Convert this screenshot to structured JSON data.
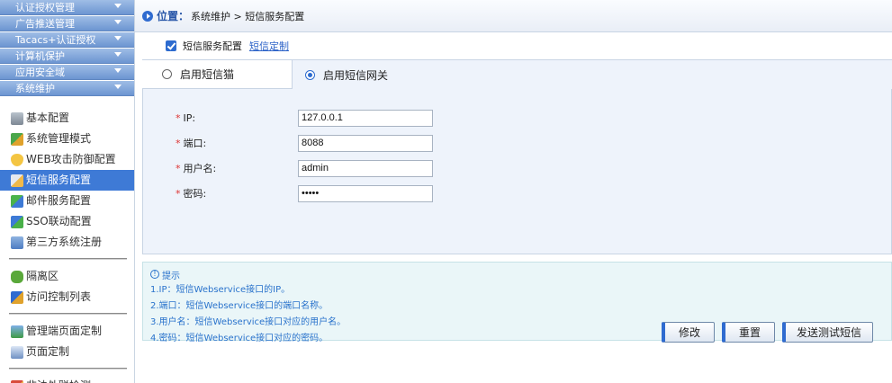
{
  "sidebar": {
    "headers": [
      {
        "label": "认证授权管理"
      },
      {
        "label": "广告推送管理"
      },
      {
        "label": "Tacacs+认证授权"
      },
      {
        "label": "计算机保护"
      },
      {
        "label": "应用安全域"
      },
      {
        "label": "系统维护"
      }
    ],
    "items": [
      {
        "label": "基本配置",
        "icon": "server-config-icon"
      },
      {
        "label": "系统管理模式",
        "icon": "tools-icon"
      },
      {
        "label": "WEB攻击防御配置",
        "icon": "shield-icon"
      },
      {
        "label": "短信服务配置",
        "icon": "sms-icon"
      },
      {
        "label": "邮件服务配置",
        "icon": "mail-icon"
      },
      {
        "label": "SSO联动配置",
        "icon": "sso-icon"
      },
      {
        "label": "第三方系统注册",
        "icon": "register-icon"
      },
      {
        "label": "隔离区",
        "icon": "quarantine-icon"
      },
      {
        "label": "访问控制列表",
        "icon": "acl-icon"
      },
      {
        "label": "管理端页面定制",
        "icon": "admin-page-icon"
      },
      {
        "label": "页面定制",
        "icon": "page-icon"
      },
      {
        "label": "非法外联检测",
        "icon": "detect-icon"
      }
    ]
  },
  "breadcrumb": {
    "label": "位置：",
    "path": "系统维护 > 短信服务配置"
  },
  "tabs": {
    "sms_config": "短信服务配置",
    "sms_custom": "短信定制"
  },
  "modes": {
    "cat": "启用短信猫",
    "gateway": "启用短信网关"
  },
  "form": {
    "ip_label": "IP:",
    "ip_value": "127.0.0.1",
    "port_label": "端口:",
    "port_value": "8088",
    "user_label": "用户名:",
    "user_value": "admin",
    "pwd_label": "密码:",
    "pwd_value": "•••••"
  },
  "tips": {
    "title": "提示",
    "lines": [
      "1.IP：短信Webservice接口的IP。",
      "2.端口：短信Webservice接口的端口名称。",
      "3.用户名：短信Webservice接口对应的用户名。",
      "4.密码：短信Webservice接口对应的密码。"
    ]
  },
  "buttons": {
    "modify": "修改",
    "reset": "重置",
    "send_test": "发送测试短信"
  },
  "colors": {
    "accent": "#3e7ad6",
    "menu_header": "#6c95d1",
    "form_bg": "#eef3fb",
    "tips_bg": "#eaf6f8",
    "required": "#dd3333"
  }
}
